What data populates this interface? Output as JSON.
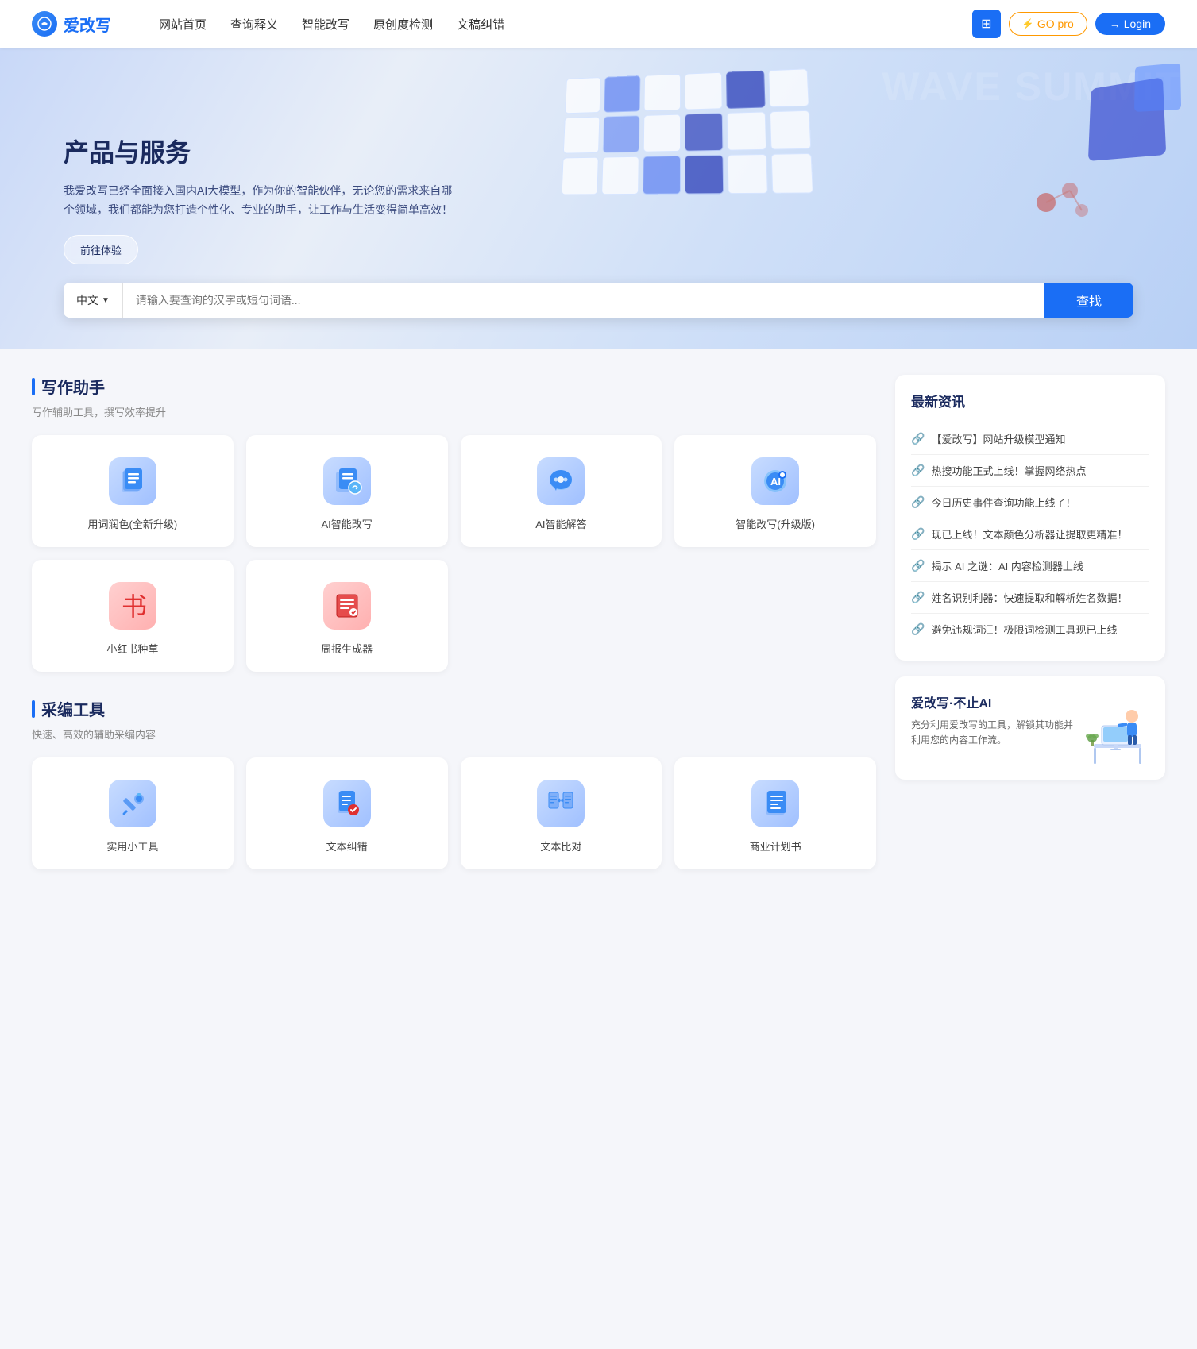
{
  "navbar": {
    "logo_text": "爱改写",
    "menu": [
      {
        "label": "网站首页",
        "id": "home"
      },
      {
        "label": "查询释义",
        "id": "query"
      },
      {
        "label": "智能改写",
        "id": "rewrite"
      },
      {
        "label": "原创度检测",
        "id": "detect"
      },
      {
        "label": "文稿纠错",
        "id": "correct"
      }
    ],
    "btn_grid_label": "⊞",
    "btn_go_pro_label": "GO pro",
    "btn_login_label": "Login"
  },
  "hero": {
    "title": "产品与服务",
    "desc": "我爱改写已经全面接入国内AI大模型，作为你的智能伙伴，无论您的需求来自哪个领域，我们都能为您打造个性化、专业的助手，让工作与生活变得简单高效！",
    "btn_label": "前往体验",
    "search": {
      "lang": "中文",
      "placeholder": "请输入要查询的汉字或短句词语...",
      "btn_label": "查找"
    }
  },
  "writing": {
    "section_title": "写作助手",
    "section_desc": "写作辅助工具，撰写效率提升",
    "cards": [
      {
        "id": "word-color",
        "label": "用词润色(全新升级)",
        "icon": "📝",
        "color": "#3a8cf5"
      },
      {
        "id": "ai-rewrite",
        "label": "AI智能改写",
        "icon": "🔄",
        "color": "#3a8cf5"
      },
      {
        "id": "ai-qa",
        "label": "AI智能解答",
        "icon": "💬",
        "color": "#3a8cf5"
      },
      {
        "id": "smart-rewrite",
        "label": "智能改写(升级版)",
        "icon": "🤖",
        "color": "#3a8cf5"
      },
      {
        "id": "redbook",
        "label": "小红书种草",
        "icon": "📖",
        "color": "#e03030"
      },
      {
        "id": "weekly",
        "label": "周报生成器",
        "icon": "📄",
        "color": "#e03030"
      }
    ]
  },
  "editing": {
    "section_title": "采编工具",
    "section_desc": "快速、高效的辅助采编内容",
    "cards": [
      {
        "id": "small-tools",
        "label": "实用小工具",
        "icon": "🔧",
        "color": "#3a8cf5"
      },
      {
        "id": "text-correct",
        "label": "文本纠错",
        "icon": "✏️",
        "color": "#3a8cf5"
      },
      {
        "id": "text-compare",
        "label": "文本比对",
        "icon": "⚖️",
        "color": "#3a8cf5"
      },
      {
        "id": "business-plan",
        "label": "商业计划书",
        "icon": "📊",
        "color": "#3a8cf5"
      }
    ]
  },
  "news": {
    "title": "最新资讯",
    "items": [
      {
        "text": "【爱改写】网站升级模型通知"
      },
      {
        "text": "热搜功能正式上线！掌握网络热点"
      },
      {
        "text": "今日历史事件查询功能上线了！"
      },
      {
        "text": "现已上线！文本颜色分析器让提取更精准！"
      },
      {
        "text": "揭示 AI 之谜：AI 内容检测器上线"
      },
      {
        "text": "姓名识别利器：快速提取和解析姓名数据！"
      },
      {
        "text": "避免违规词汇！极限词检测工具现已上线"
      }
    ]
  },
  "promo": {
    "title": "爱改写·不止AI",
    "desc": "充分利用爱改写的工具，解锁其功能并利用您的内容工作流。"
  }
}
